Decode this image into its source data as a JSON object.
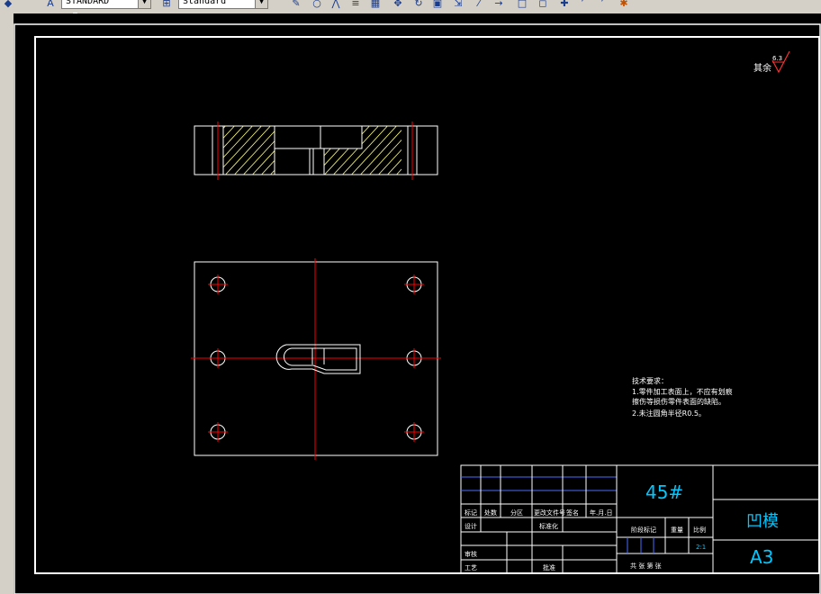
{
  "toolbar": {
    "text_style": "STANDARD",
    "dim_style": "Standard",
    "icons": [
      "text-style-icon",
      "dim-style-icon",
      "pencil-icon",
      "circle-draw-icon",
      "mirror-icon",
      "offset-icon",
      "array-icon",
      "move-icon",
      "rotate-icon",
      "scale-icon",
      "stretch-icon",
      "trim-icon",
      "extend-icon",
      "break-icon",
      "chamfer-icon",
      "fillet-icon",
      "explode-icon"
    ]
  },
  "drawing": {
    "roughness_note": "其余",
    "roughness_value": "6.3",
    "tech_requirements": {
      "heading": "技术要求：",
      "line1": "1.零件加工表面上，不应有划痕",
      "line2": "擦伤等损伤零件表面的缺陷。",
      "line3": "2.未注圆角半径R0.5。"
    },
    "title_block": {
      "material": "45#",
      "part_name": "凹模",
      "sheet_size": "A3",
      "scale": "2:1",
      "labels": {
        "mark": "标记",
        "count": "处数",
        "zone": "分区",
        "change_doc": "更改文件号",
        "signature": "签名",
        "date": "年.月.日",
        "design": "设计",
        "standardize": "标准化",
        "stage_mark": "阶段标记",
        "weight": "重量",
        "ratio": "比例",
        "review": "审核",
        "process": "工艺",
        "approve": "批准",
        "sheets": "共    张    第    张"
      }
    },
    "colors": {
      "background": "#000000",
      "outline": "#ffffff",
      "centerline": "#ff0000",
      "hatch": "#ffff80",
      "title_text": "#00c8ff",
      "roughness_symbol": "#ff3030"
    }
  }
}
